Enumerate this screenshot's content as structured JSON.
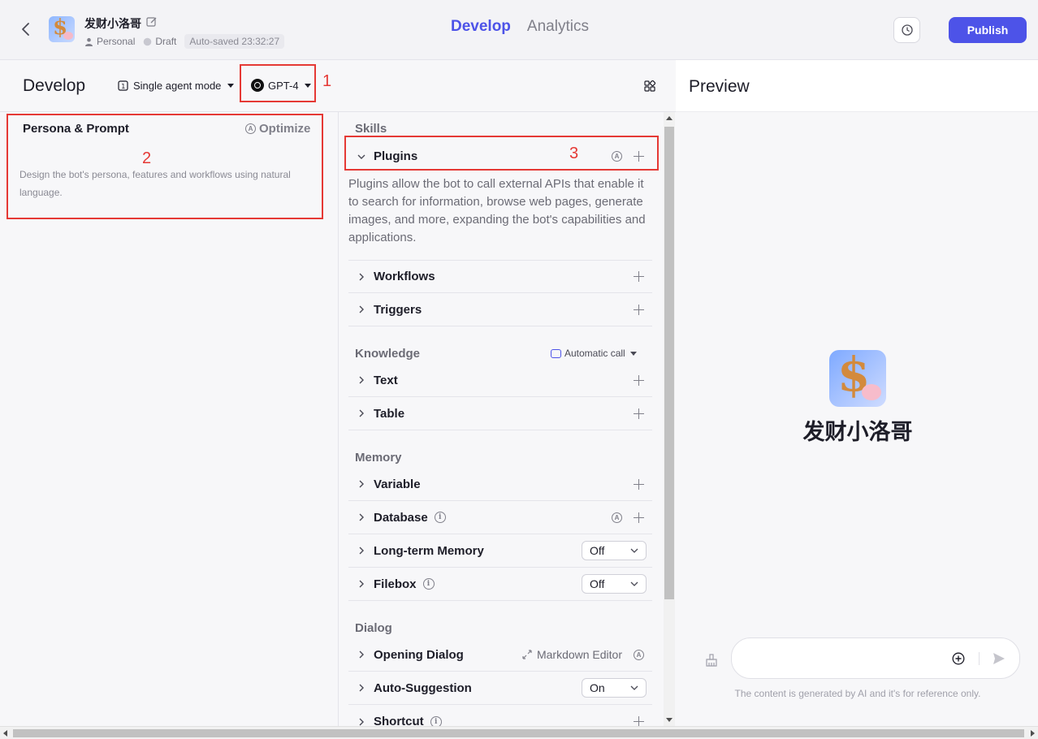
{
  "header": {
    "bot_name": "发财小洛哥",
    "workspace": "Personal",
    "status": "Draft",
    "autosave": "Auto-saved 23:32:27",
    "tabs": [
      {
        "label": "Develop",
        "active": true
      },
      {
        "label": "Analytics",
        "active": false
      }
    ],
    "publish_label": "Publish"
  },
  "develop": {
    "title": "Develop",
    "mode_label": "Single agent mode",
    "model_label": "GPT-4"
  },
  "persona": {
    "title": "Persona & Prompt",
    "optimize_label": "Optimize",
    "placeholder": "Design the bot's persona, features and workflows using natural language."
  },
  "skills": {
    "section_label": "Skills",
    "plugins": {
      "label": "Plugins",
      "description": "Plugins allow the bot to call external APIs that enable it to search for information, browse web pages, generate images, and more, expanding the bot's capabilities and applications."
    },
    "workflows_label": "Workflows",
    "triggers_label": "Triggers"
  },
  "knowledge": {
    "section_label": "Knowledge",
    "call_mode": "Automatic call",
    "text_label": "Text",
    "table_label": "Table"
  },
  "memory": {
    "section_label": "Memory",
    "variable_label": "Variable",
    "database_label": "Database",
    "longterm_label": "Long-term Memory",
    "longterm_value": "Off",
    "filebox_label": "Filebox",
    "filebox_value": "Off"
  },
  "dialog": {
    "section_label": "Dialog",
    "opening_label": "Opening Dialog",
    "markdown_label": "Markdown Editor",
    "autosuggest_label": "Auto-Suggestion",
    "autosuggest_value": "On",
    "shortcut_label": "Shortcut"
  },
  "preview": {
    "title": "Preview",
    "bot_name": "发财小洛哥",
    "disclaimer": "The content is generated by AI and it's for reference only."
  },
  "annotations": {
    "box1": "1",
    "box2": "2",
    "box3": "3"
  },
  "colors": {
    "accent": "#4d53e8",
    "annotation_red": "#e53935"
  }
}
